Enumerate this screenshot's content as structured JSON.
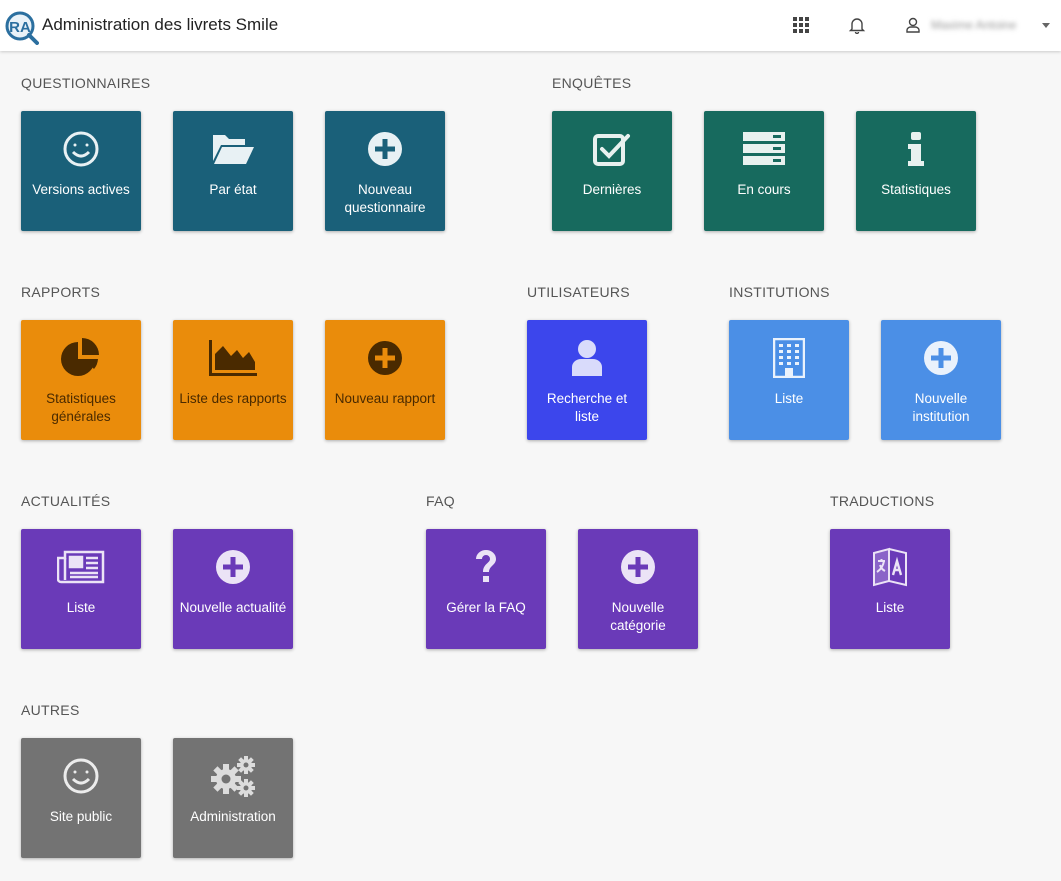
{
  "app": {
    "title": "Administration des livrets Smile",
    "logo_text": "RA"
  },
  "header": {
    "icons": [
      "apps-grid-icon",
      "bell-icon",
      "user-icon",
      "chevron-down-icon"
    ],
    "user_name": "Maxime Antoine"
  },
  "colors": {
    "questionnaires": "#1a6079",
    "enquetes": "#176a5e",
    "rapports": "#ea8c0b",
    "utilisateurs": "#3c46ec",
    "institutions": "#4b8fe6",
    "actualites": "#6a3ab8",
    "autres": "#737373"
  },
  "sections": {
    "questionnaires": {
      "title": "QUESTIONNAIRES",
      "tiles": [
        {
          "icon": "smiley-icon",
          "label": "Versions actives"
        },
        {
          "icon": "folder-open-icon",
          "label": "Par état"
        },
        {
          "icon": "plus-circle-icon",
          "label": "Nouveau questionnaire"
        }
      ]
    },
    "enquetes": {
      "title": "ENQUÊTES",
      "tiles": [
        {
          "icon": "checkbox-icon",
          "label": "Dernières"
        },
        {
          "icon": "server-icon",
          "label": "En cours"
        },
        {
          "icon": "info-icon",
          "label": "Statistiques"
        }
      ]
    },
    "rapports": {
      "title": "RAPPORTS",
      "tiles": [
        {
          "icon": "pie-chart-icon",
          "label": "Statistiques générales"
        },
        {
          "icon": "area-chart-icon",
          "label": "Liste des rapports"
        },
        {
          "icon": "plus-circle-icon",
          "label": "Nouveau rapport"
        }
      ]
    },
    "utilisateurs": {
      "title": "UTILISATEURS",
      "tiles": [
        {
          "icon": "user-icon",
          "label": "Recherche et liste"
        }
      ]
    },
    "institutions": {
      "title": "INSTITUTIONS",
      "tiles": [
        {
          "icon": "building-icon",
          "label": "Liste"
        },
        {
          "icon": "plus-circle-icon",
          "label": "Nouvelle institution"
        }
      ]
    },
    "actualites": {
      "title": "ACTUALITÉS",
      "tiles": [
        {
          "icon": "newspaper-icon",
          "label": "Liste"
        },
        {
          "icon": "plus-circle-icon",
          "label": "Nouvelle actualité"
        }
      ]
    },
    "faq": {
      "title": "FAQ",
      "tiles": [
        {
          "icon": "question-icon",
          "label": "Gérer la FAQ"
        },
        {
          "icon": "plus-circle-icon",
          "label": "Nouvelle catégorie"
        }
      ]
    },
    "traductions": {
      "title": "TRADUCTIONS",
      "tiles": [
        {
          "icon": "translate-icon",
          "label": "Liste"
        }
      ]
    },
    "autres": {
      "title": "AUTRES",
      "tiles": [
        {
          "icon": "smiley-icon",
          "label": "Site public"
        },
        {
          "icon": "gears-icon",
          "label": "Administration"
        }
      ]
    }
  }
}
